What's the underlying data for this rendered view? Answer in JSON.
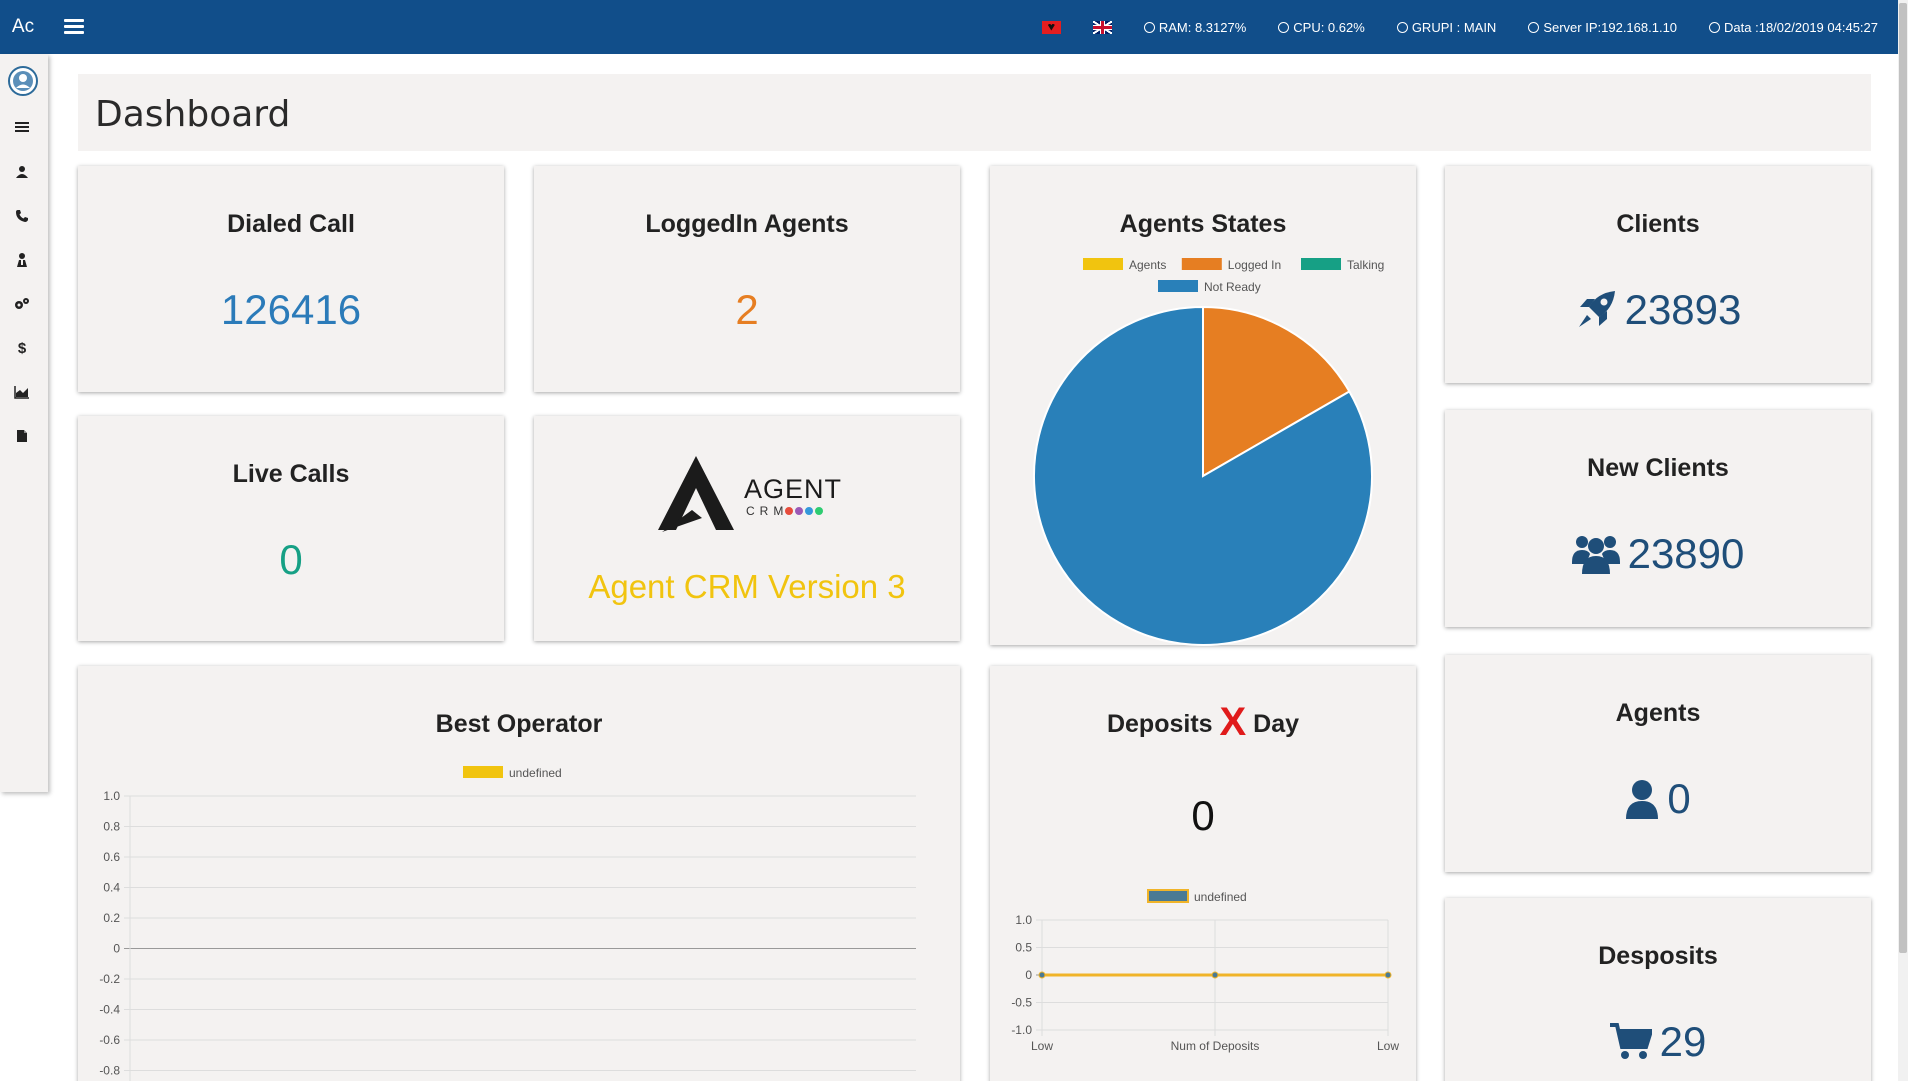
{
  "topbar": {
    "brand": "Ac",
    "stats": [
      {
        "label": "RAM: 8.3127%"
      },
      {
        "label": "CPU: 0.62%"
      },
      {
        "label": "GRUPI : MAIN"
      },
      {
        "label": "Server IP:192.168.1.10"
      },
      {
        "label": "Data :18/02/2019 04:45:27"
      }
    ],
    "flags": [
      "albania-flag",
      "uk-flag"
    ]
  },
  "sidebar": {
    "items": [
      "list-icon",
      "user-icon",
      "phone-icon",
      "agent-icon",
      "settings-icon",
      "dollar-icon",
      "area-chart-icon",
      "file-icon"
    ]
  },
  "page": {
    "title": "Dashboard"
  },
  "cards": {
    "dialed_call": {
      "title": "Dialed Call",
      "value": "126416",
      "color": "#2b7bb9"
    },
    "loggedin_agents": {
      "title": "LoggedIn Agents",
      "value": "2",
      "color": "#e67e22"
    },
    "live_calls": {
      "title": "Live Calls",
      "value": "0",
      "color": "#16a085"
    },
    "crm": {
      "logo_word": "AGENT",
      "logo_sub": "CRM",
      "version": "Agent CRM Version 3",
      "color": "#f1c40f"
    },
    "clients": {
      "title": "Clients",
      "value": "23893",
      "icon": "rocket-icon"
    },
    "new_clients": {
      "title": "New Clients",
      "value": "23890",
      "icon": "users-icon"
    },
    "agents": {
      "title": "Agents",
      "value": "0",
      "icon": "user-icon"
    },
    "deposits": {
      "title": "Desposits",
      "value": "29",
      "icon": "cart-icon"
    },
    "deposits_x_day": {
      "title_left": "Deposits",
      "title_x": "X",
      "title_right": "Day",
      "value": "0"
    },
    "best_operator": {
      "title": "Best Operator"
    }
  },
  "chart_data": [
    {
      "type": "pie",
      "title": "Agents States",
      "legend": [
        {
          "name": "Agents",
          "color": "#f1c40f"
        },
        {
          "name": "Logged In",
          "color": "#e67e22"
        },
        {
          "name": "Talking",
          "color": "#16a085"
        },
        {
          "name": "Not Ready",
          "color": "#2980b9"
        }
      ],
      "values": [
        0,
        1,
        0,
        5
      ]
    },
    {
      "type": "bar",
      "title": "Best Operator",
      "series": [
        {
          "name": "undefined",
          "values": [],
          "color": "#f1c40f"
        }
      ],
      "yticks": [
        "1.0",
        "0.8",
        "0.6",
        "0.4",
        "0.2",
        "0",
        "-0.2",
        "-0.4",
        "-0.6",
        "-0.8"
      ],
      "ylim": [
        -1,
        1
      ],
      "grid": true,
      "legend": "top"
    },
    {
      "type": "line",
      "title": "Deposits X Day",
      "categories": [
        "Low",
        "Num of Deposits",
        "Low"
      ],
      "series": [
        {
          "name": "undefined",
          "values": [
            0,
            0,
            0
          ],
          "color": "#f0b429",
          "legend_fill": "#4a7a94"
        }
      ],
      "yticks": [
        "1.0",
        "0.5",
        "0",
        "-0.5",
        "-1.0"
      ],
      "ylim": [
        -1,
        1
      ],
      "grid": true,
      "legend": "top"
    }
  ]
}
